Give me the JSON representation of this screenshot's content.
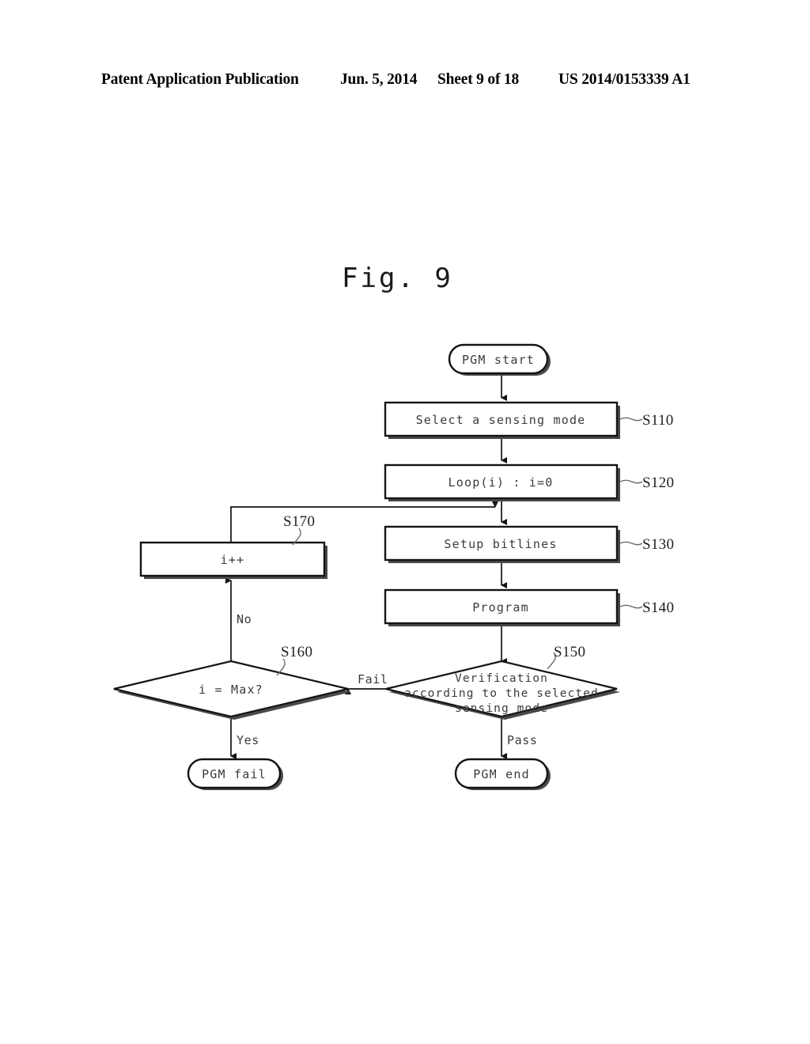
{
  "header": {
    "publication": "Patent Application Publication",
    "date": "Jun. 5, 2014",
    "sheet": "Sheet 9 of 18",
    "patent_number": "US 2014/0153339 A1"
  },
  "figure": {
    "title": "Fig.  9"
  },
  "flowchart": {
    "nodes": {
      "start": {
        "label": "PGM start",
        "shape": "terminator"
      },
      "s110": {
        "label": "Select a sensing mode",
        "shape": "process",
        "step": "S110"
      },
      "s120": {
        "label": "Loop(i) : i=0",
        "shape": "process",
        "step": "S120"
      },
      "s130": {
        "label": "Setup bitlines",
        "shape": "process",
        "step": "S130"
      },
      "s140": {
        "label": "Program",
        "shape": "process",
        "step": "S140"
      },
      "s150": {
        "label_line1": "Verification",
        "label_line2": "according to the selected",
        "label_line3": "sensing mode",
        "shape": "decision",
        "step": "S150"
      },
      "s160": {
        "label": "i = Max?",
        "shape": "decision",
        "step": "S160"
      },
      "s170": {
        "label": "i++",
        "shape": "process",
        "step": "S170"
      },
      "pgm_fail": {
        "label": "PGM fail",
        "shape": "terminator"
      },
      "pgm_end": {
        "label": "PGM end",
        "shape": "terminator"
      }
    },
    "edge_labels": {
      "pass": "Pass",
      "fail": "Fail",
      "yes": "Yes",
      "no": "No"
    }
  },
  "colors": {
    "ink": "#141414",
    "text": "#3b3b3b",
    "shadow": "#4a4a4a",
    "leader": "#6a6a6a",
    "paper": "#ffffff"
  }
}
